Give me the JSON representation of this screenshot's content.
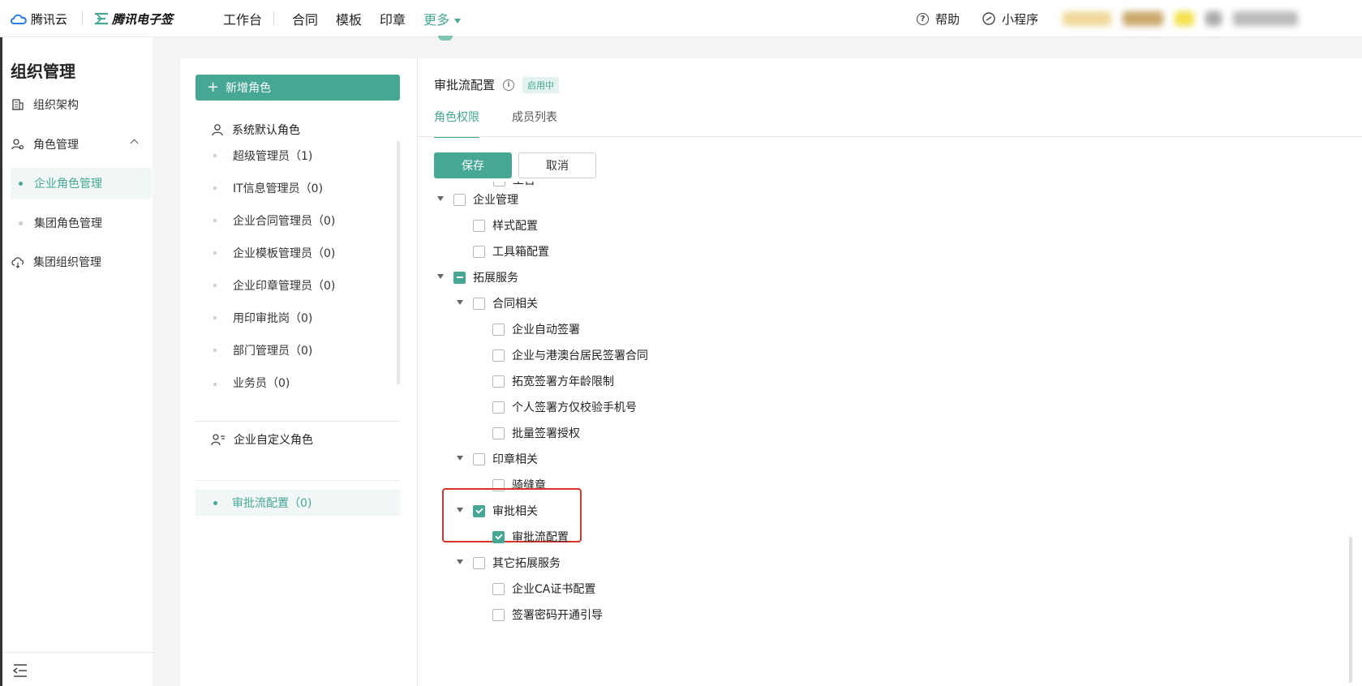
{
  "topbar": {
    "brand_tencent": "腾讯云",
    "brand_esign": "腾讯电子签",
    "nav": [
      "工作台",
      "合同",
      "模板",
      "印章",
      "更多"
    ],
    "help": "帮助",
    "miniprogram": "小程序"
  },
  "sidebar": {
    "title": "组织管理",
    "org_structure": "组织架构",
    "role_mgmt": "角色管理",
    "enterprise_role_mgmt": "企业角色管理",
    "group_role_mgmt": "集团角色管理",
    "group_org_mgmt": "集团组织管理"
  },
  "roles": {
    "add_button": "新增角色",
    "system_group": "系统默认角色",
    "system_roles": [
      "超级管理员（1)",
      "IT信息管理员（0)",
      "企业合同管理员（0)",
      "企业模板管理员（0)",
      "企业印章管理员（0)",
      "用印审批岗（0)",
      "部门管理员（0)",
      "业务员（0)"
    ],
    "custom_group": "企业自定义角色",
    "custom_active": "审批流配置（0)"
  },
  "main": {
    "title": "审批流配置",
    "status_badge": "启用中",
    "tab_permissions": "角色权限",
    "tab_members": "成员列表",
    "save": "保存",
    "cancel": "取消"
  },
  "tree": {
    "partial_top": "工台",
    "enterprise_mgmt": "企业管理",
    "style_config": "样式配置",
    "toolbox_config": "工具箱配置",
    "ext_services": "拓展服务",
    "contract_related": "合同相关",
    "auto_sign": "企业自动签署",
    "hk_macau_tw_sign": "企业与港澳台居民签署合同",
    "age_limit": "拓宽签署方年龄限制",
    "phone_verify": "个人签署方仅校验手机号",
    "batch_auth": "批量签署授权",
    "seal_related": "印章相关",
    "paging_seal": "骑缝章",
    "approval_related": "审批相关",
    "approval_flow_config": "审批流配置",
    "other_ext": "其它拓展服务",
    "ca_cert": "企业CA证书配置",
    "sign_password": "签署密码开通引导"
  },
  "colors": {
    "accent": "#46a795",
    "highlight": "#d9362b"
  }
}
